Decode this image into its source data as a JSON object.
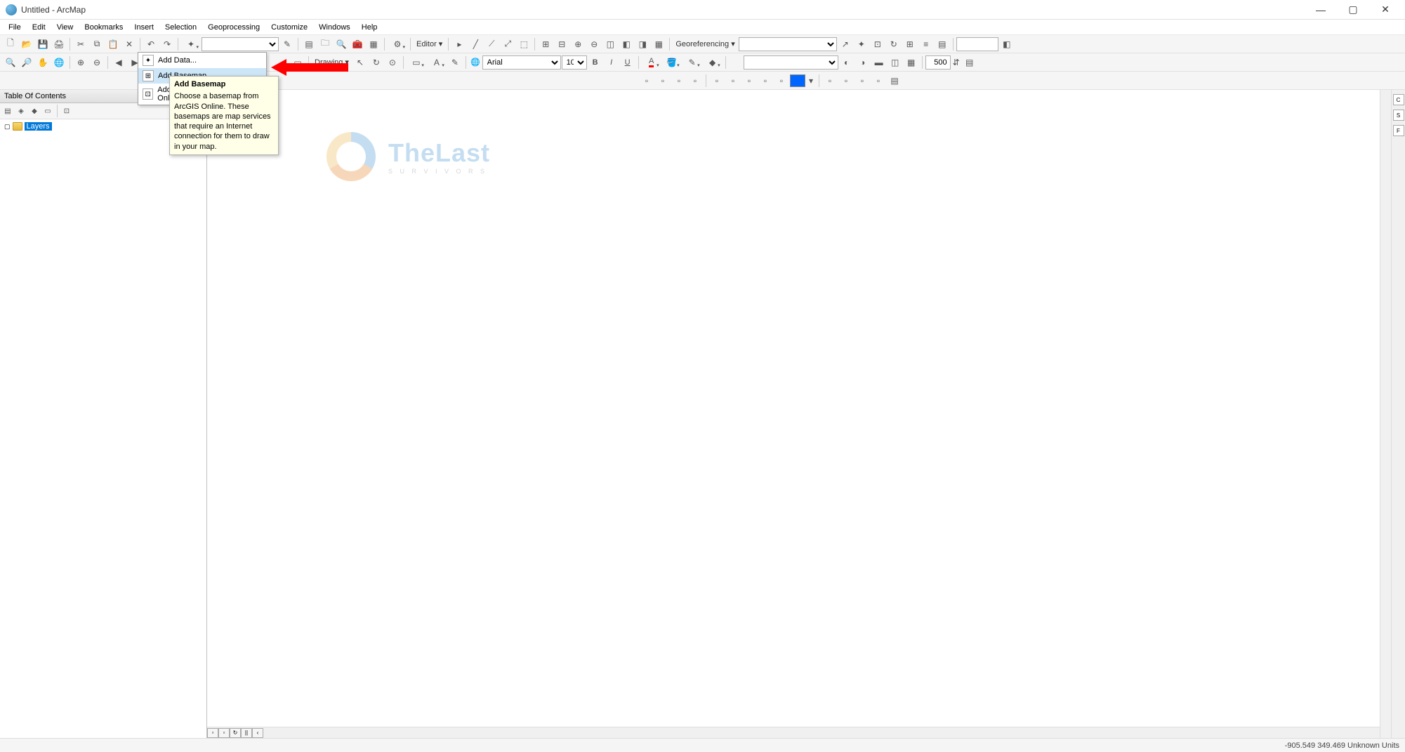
{
  "window": {
    "title": "Untitled - ArcMap"
  },
  "menu": {
    "file": "File",
    "edit": "Edit",
    "view": "View",
    "bookmarks": "Bookmarks",
    "insert": "Insert",
    "selection": "Selection",
    "geoprocessing": "Geoprocessing",
    "customize": "Customize",
    "windows": "Windows",
    "help": "Help"
  },
  "toolbar": {
    "editor_label": "Editor",
    "georef_label": "Georeferencing",
    "drawing_label": "Drawing",
    "font_name": "Arial",
    "font_size": "10",
    "stepper_value": "500"
  },
  "dropdown": {
    "add_data": "Add Data...",
    "add_basemap": "Add Basemap...",
    "add_arcgis_online": "Add Data From ArcGIS Online..."
  },
  "tooltip": {
    "title": "Add Basemap",
    "body": "Choose a basemap from ArcGIS Online. These basemaps are map services that require an Internet connection for them to draw in your map."
  },
  "toc": {
    "header": "Table Of Contents",
    "layers_label": "Layers"
  },
  "watermark": {
    "main": "TheLast",
    "sub": "S U R V I V O R S"
  },
  "status": {
    "coords": "-905.549 349.469 Unknown Units"
  }
}
